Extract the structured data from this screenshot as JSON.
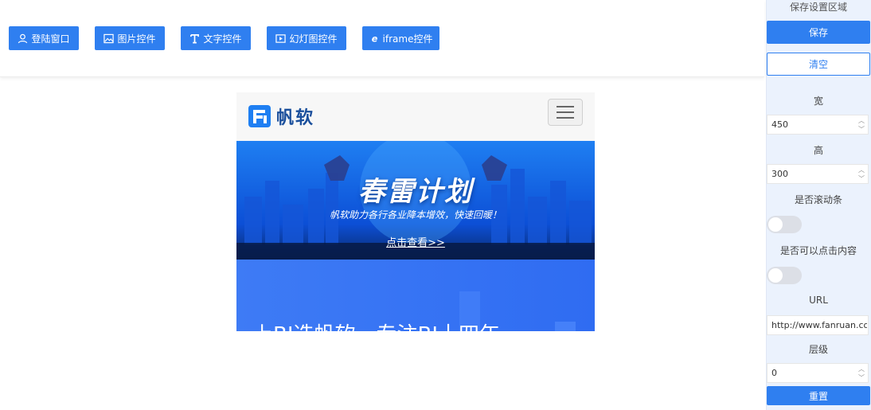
{
  "toolbar": {
    "buttons": [
      {
        "label": "登陆窗口",
        "icon": "user-icon"
      },
      {
        "label": "图片控件",
        "icon": "image-icon"
      },
      {
        "label": "文字控件",
        "icon": "text-icon"
      },
      {
        "label": "幻灯图控件",
        "icon": "slideshow-icon"
      },
      {
        "label": "iframe控件",
        "icon": "ie-icon"
      }
    ]
  },
  "preview": {
    "logo_text": "帆软",
    "banner_title": "春雷计划",
    "banner_subtitle": "帆软助力各行各业降本增效，快速回暖！",
    "banner_link": "点击查看>>",
    "hero_text": "上BI选帆软，专注BI十四年"
  },
  "panel": {
    "title": "保存设置区域",
    "save_label": "保存",
    "clear_label": "清空",
    "width_label": "宽",
    "width_value": "450",
    "height_label": "高",
    "height_value": "300",
    "scroll_label": "是否滚动条",
    "clickable_label": "是否可以点击内容",
    "url_label": "URL",
    "url_value": "http://www.fanruan.com",
    "layer_label": "层级",
    "layer_value": "0",
    "reset_label": "重置"
  },
  "colors": {
    "primary": "#2f7ff0",
    "panel_bg": "#ebf2fd",
    "banner_blue": "#1f7ff2"
  }
}
